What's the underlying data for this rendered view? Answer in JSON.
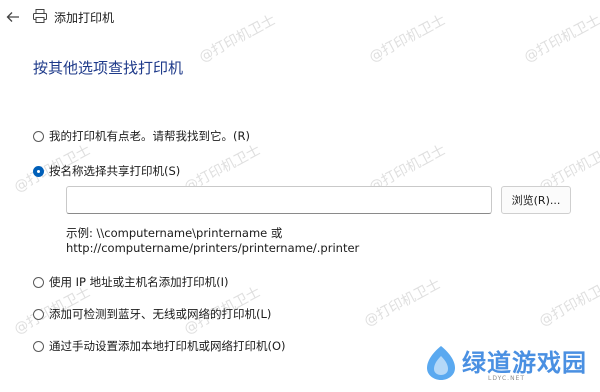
{
  "window": {
    "title": "添加打印机"
  },
  "page": {
    "heading": "按其他选项查找打印机"
  },
  "options": [
    {
      "label": "我的打印机有点老。请帮我找到它。(R)",
      "checked": false
    },
    {
      "label": "按名称选择共享打印机(S)",
      "checked": true
    },
    {
      "label": "使用 IP 地址或主机名添加打印机(I)",
      "checked": false
    },
    {
      "label": "添加可检测到蓝牙、无线或网络的打印机(L)",
      "checked": false
    },
    {
      "label": "通过手动设置添加本地打印机或网络打印机(O)",
      "checked": false
    }
  ],
  "share_name": {
    "value": "",
    "browse_label": "浏览(R)..."
  },
  "example": {
    "line1": "示例: \\\\computername\\printername 或",
    "line2": "http://computername/printers/printername/.printer"
  },
  "watermark": {
    "text": "@打印机卫士"
  },
  "brand": {
    "name": "绿道游戏园",
    "sub": "LDYC.NET"
  },
  "icons": {
    "back": "back-arrow-icon",
    "printer": "printer-icon",
    "brand": "brand-logo-icon"
  }
}
